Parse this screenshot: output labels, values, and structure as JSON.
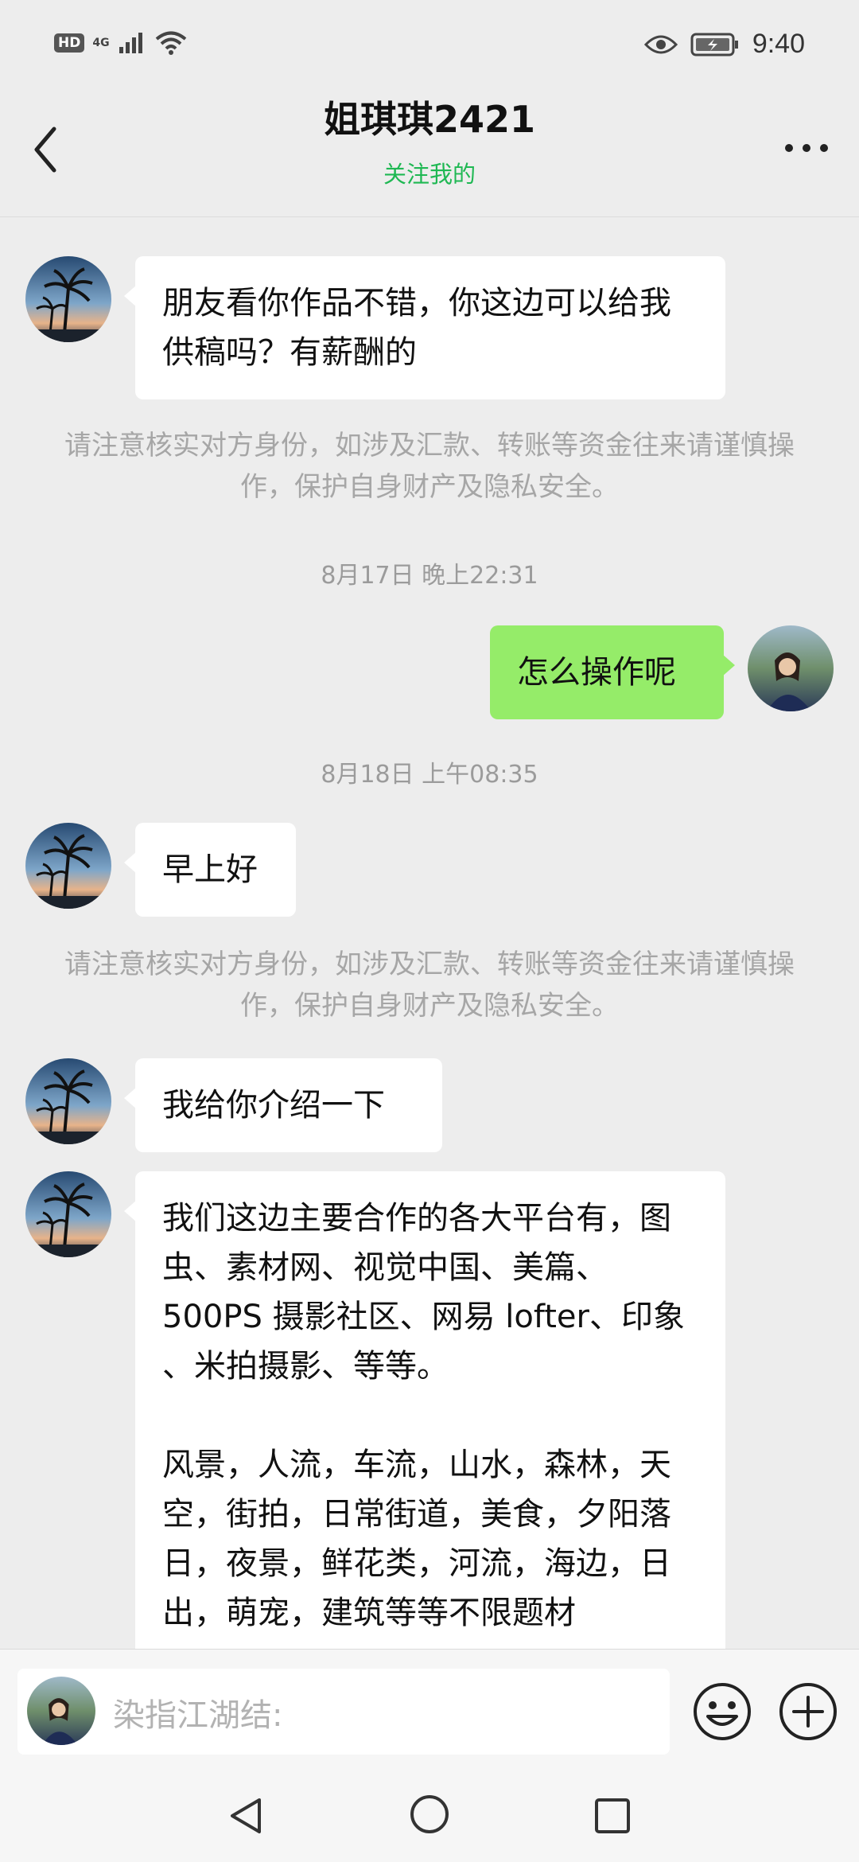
{
  "status_bar": {
    "hd_label": "HD",
    "network_label": "4G",
    "time": "9:40"
  },
  "header": {
    "title": "姐琪琪2421",
    "subtitle": "关注我的"
  },
  "messages": {
    "m1": "朋友看你作品不错，你这边可以给我供稿吗？有薪酬的",
    "notice1": "请注意核实对方身份，如涉及汇款、转账等资金往来请谨慎操作，保护自身财产及隐私安全。",
    "ts1": "8月17日 晚上22:31",
    "m2": "怎么操作呢",
    "ts2": "8月18日 上午08:35",
    "m3": "早上好",
    "notice2": "请注意核实对方身份，如涉及汇款、转账等资金往来请谨慎操作，保护自身财产及隐私安全。",
    "m4": "我给你介绍一下",
    "m5": "我们这边主要合作的各大平台有，图虫、素材网、视觉中国、美篇、500PS 摄影社区、网易 lofter、印象 、米拍摄影、等等。\n\n风景，人流，车流，山水，森林，天空，街拍，日常街道，美食，夕阳落日，夜景，鲜花类，河流，海边，日出，萌宠，建筑等等不限题材"
  },
  "input": {
    "placeholder": "染指江湖结:"
  },
  "colors": {
    "accent_green": "#1fb853",
    "sent_bubble": "#95ec69",
    "background": "#ededed"
  },
  "icons": [
    "back-arrow-icon",
    "more-icon",
    "emoji-icon",
    "plus-icon",
    "nav-back-icon",
    "nav-home-icon",
    "nav-recent-icon",
    "eye-icon",
    "battery-icon",
    "wifi-icon",
    "signal-icon"
  ]
}
